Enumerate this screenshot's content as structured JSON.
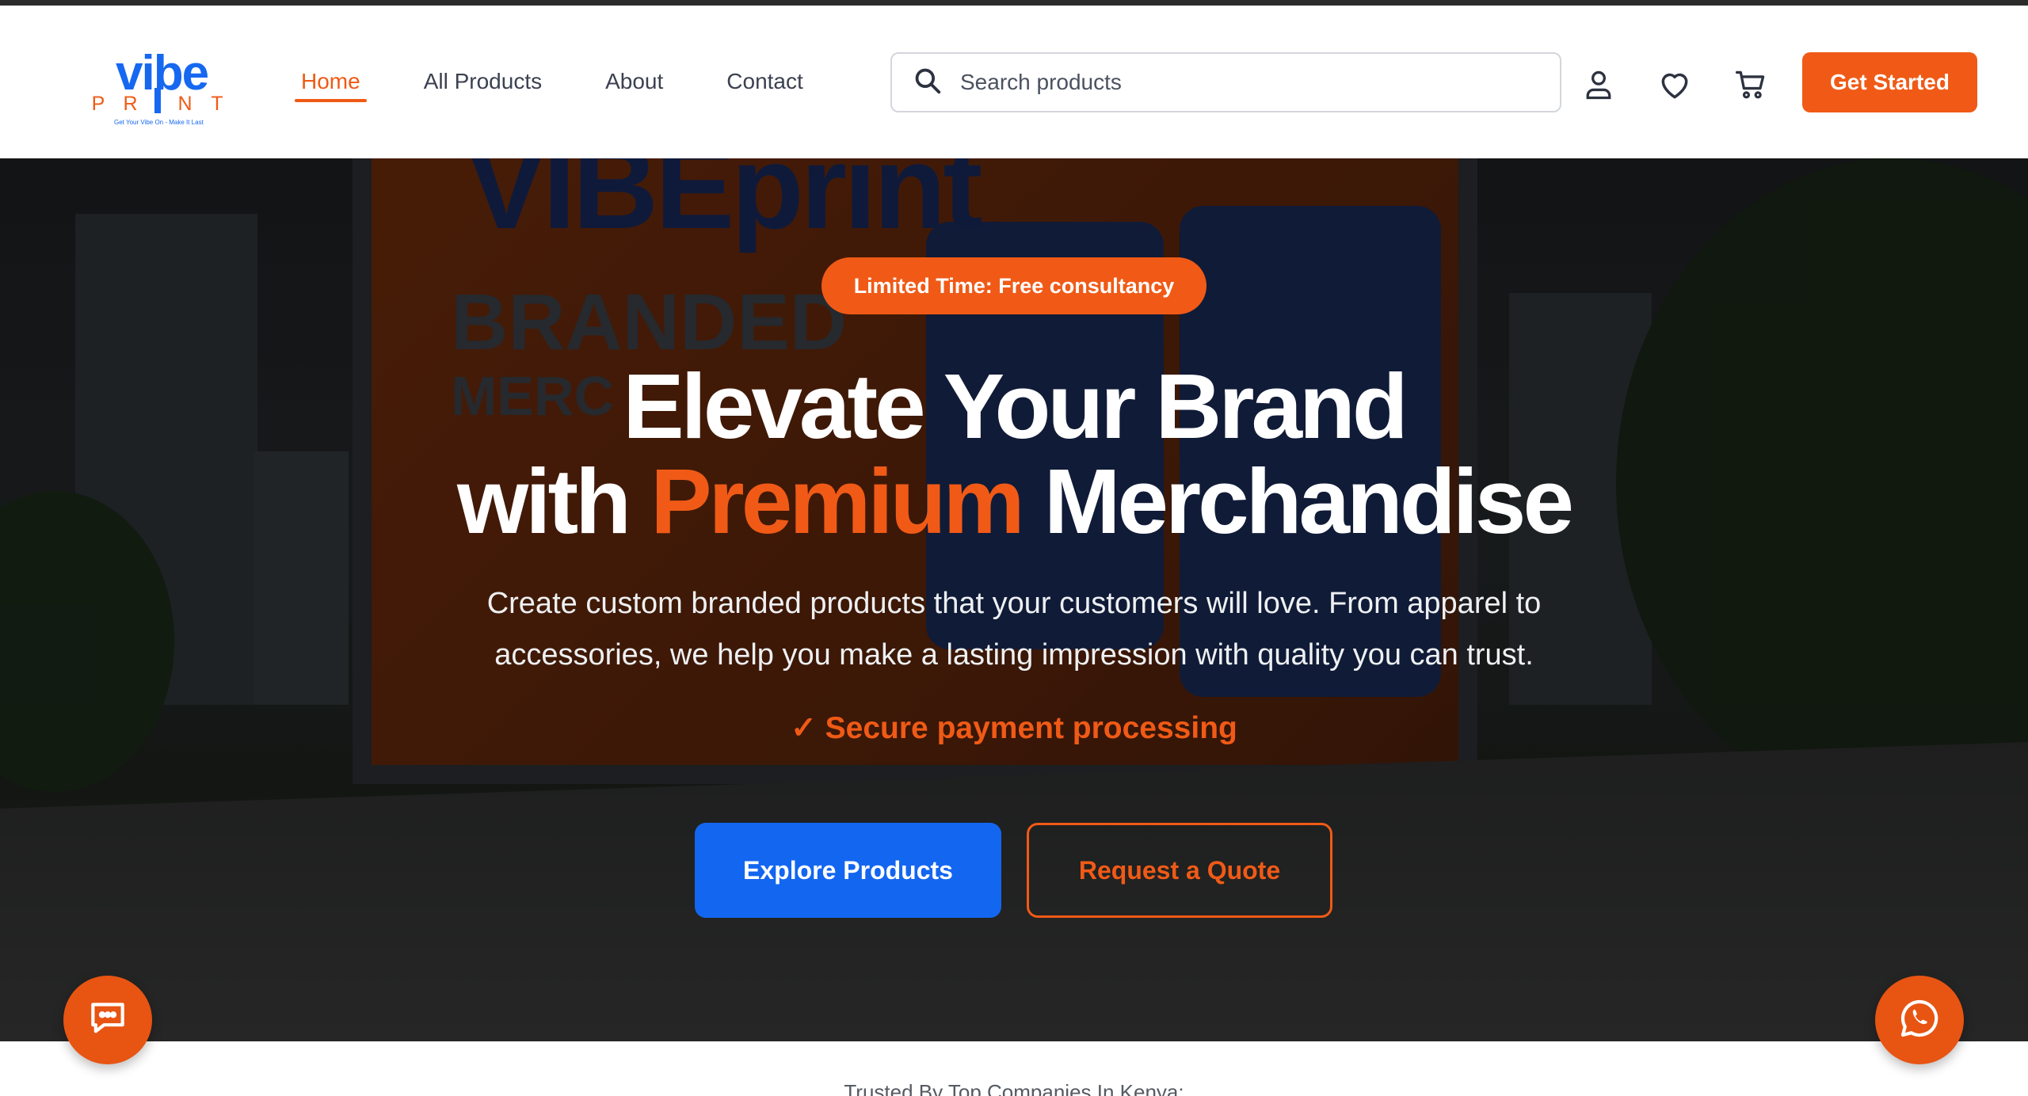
{
  "brand": {
    "logo_top": "vibe",
    "logo_bottom_letters": [
      "P",
      "R",
      "N",
      "T"
    ],
    "tagline": "Get Your Vibe On - Make It Last",
    "primary_color": "#f05a16",
    "secondary_color": "#1668f0"
  },
  "nav": {
    "items": [
      {
        "label": "Home",
        "active": true
      },
      {
        "label": "All Products",
        "active": false
      },
      {
        "label": "About",
        "active": false
      },
      {
        "label": "Contact",
        "active": false
      }
    ]
  },
  "search": {
    "placeholder": "Search products",
    "icon": "search-icon"
  },
  "header_icons": [
    "user-icon",
    "heart-icon",
    "cart-icon"
  ],
  "header_cta": "Get Started",
  "hero": {
    "badge": "Limited Time: Free consultancy",
    "headline_line1": "Elevate Your Brand",
    "headline_line2_prefix": "with ",
    "headline_line2_accent": "Premium",
    "headline_line2_suffix": " Merchandise",
    "subtitle": "Create custom branded products that your customers will love. From apparel to accessories, we help you make a lasting impression with quality you can trust.",
    "secure_check": "✓",
    "secure_text": "Secure payment processing",
    "primary_button": "Explore Products",
    "secondary_button": "Request a Quote",
    "background_billboard_text": [
      "VIBEprint",
      "BRANDED",
      "MERC"
    ]
  },
  "floating": {
    "chat_icon": "chat-icon",
    "whatsapp_icon": "whatsapp-icon"
  },
  "trusted_by": "Trusted By Top Companies In Kenya:"
}
